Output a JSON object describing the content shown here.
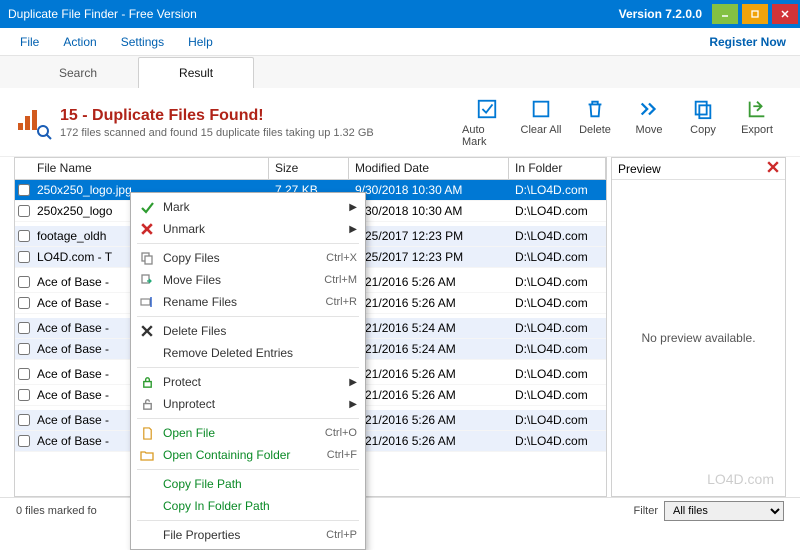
{
  "app": {
    "title": "Duplicate File Finder - Free Version",
    "version": "Version 7.2.0.0"
  },
  "menu": {
    "file": "File",
    "action": "Action",
    "settings": "Settings",
    "help": "Help",
    "register": "Register Now"
  },
  "tabs": {
    "search": "Search",
    "result": "Result"
  },
  "header": {
    "title": "15 - Duplicate Files Found!",
    "subtitle": "172 files scanned and found 15 duplicate files taking up 1.32 GB"
  },
  "toolbar": {
    "automark": "Auto Mark",
    "clearall": "Clear All",
    "delete": "Delete",
    "move": "Move",
    "copy": "Copy",
    "export": "Export"
  },
  "columns": {
    "filename": "File Name",
    "size": "Size",
    "modified": "Modified Date",
    "folder": "In Folder"
  },
  "rows": [
    {
      "fn": "250x250_logo.jpg",
      "sz": "7.27 KB",
      "md": "9/30/2018 10:30 AM",
      "fo": "D:\\LO4D.com",
      "zebra": false,
      "sel": true,
      "gap": false
    },
    {
      "fn": "250x250_logo",
      "sz": "",
      "md": "9/30/2018 10:30 AM",
      "fo": "D:\\LO4D.com",
      "zebra": false,
      "sel": false,
      "gap": true
    },
    {
      "fn": "footage_oldh",
      "sz": "",
      "md": "9/25/2017 12:23 PM",
      "fo": "D:\\LO4D.com",
      "zebra": true,
      "sel": false,
      "gap": false
    },
    {
      "fn": "LO4D.com - T",
      "sz": "",
      "md": "9/25/2017 12:23 PM",
      "fo": "D:\\LO4D.com",
      "zebra": true,
      "sel": false,
      "gap": true
    },
    {
      "fn": "Ace of Base -",
      "sz": "",
      "md": "4/21/2016 5:26 AM",
      "fo": "D:\\LO4D.com",
      "zebra": false,
      "sel": false,
      "gap": false
    },
    {
      "fn": "Ace of Base -",
      "sz": "",
      "md": "4/21/2016 5:26 AM",
      "fo": "D:\\LO4D.com",
      "zebra": false,
      "sel": false,
      "gap": true
    },
    {
      "fn": "Ace of Base -",
      "sz": "",
      "md": "4/21/2016 5:24 AM",
      "fo": "D:\\LO4D.com",
      "zebra": true,
      "sel": false,
      "gap": false
    },
    {
      "fn": "Ace of Base -",
      "sz": "",
      "md": "4/21/2016 5:24 AM",
      "fo": "D:\\LO4D.com",
      "zebra": true,
      "sel": false,
      "gap": true
    },
    {
      "fn": "Ace of Base -",
      "sz": "",
      "md": "4/21/2016 5:26 AM",
      "fo": "D:\\LO4D.com",
      "zebra": false,
      "sel": false,
      "gap": false
    },
    {
      "fn": "Ace of Base -",
      "sz": "",
      "md": "4/21/2016 5:26 AM",
      "fo": "D:\\LO4D.com",
      "zebra": false,
      "sel": false,
      "gap": true
    },
    {
      "fn": "Ace of Base -",
      "sz": "",
      "md": "4/21/2016 5:26 AM",
      "fo": "D:\\LO4D.com",
      "zebra": true,
      "sel": false,
      "gap": false
    },
    {
      "fn": "Ace of Base -",
      "sz": "",
      "md": "4/21/2016 5:26 AM",
      "fo": "D:\\LO4D.com",
      "zebra": true,
      "sel": false,
      "gap": false
    }
  ],
  "preview": {
    "title": "Preview",
    "empty": "No preview available."
  },
  "status": {
    "marked": "0 files marked fo",
    "filter_label": "Filter",
    "filter_value": "All files"
  },
  "contextmenu": {
    "mark": "Mark",
    "unmark": "Unmark",
    "copyfiles": "Copy Files",
    "copyfiles_sc": "Ctrl+X",
    "movefiles": "Move Files",
    "movefiles_sc": "Ctrl+M",
    "renamefiles": "Rename Files",
    "renamefiles_sc": "Ctrl+R",
    "deletefiles": "Delete Files",
    "removedeleted": "Remove Deleted Entries",
    "protect": "Protect",
    "unprotect": "Unprotect",
    "openfile": "Open File",
    "openfile_sc": "Ctrl+O",
    "openfolder": "Open Containing Folder",
    "openfolder_sc": "Ctrl+F",
    "copypath": "Copy File Path",
    "copyinfolder": "Copy In Folder Path",
    "fileprops": "File Properties",
    "fileprops_sc": "Ctrl+P"
  },
  "watermark": "LO4D.com"
}
